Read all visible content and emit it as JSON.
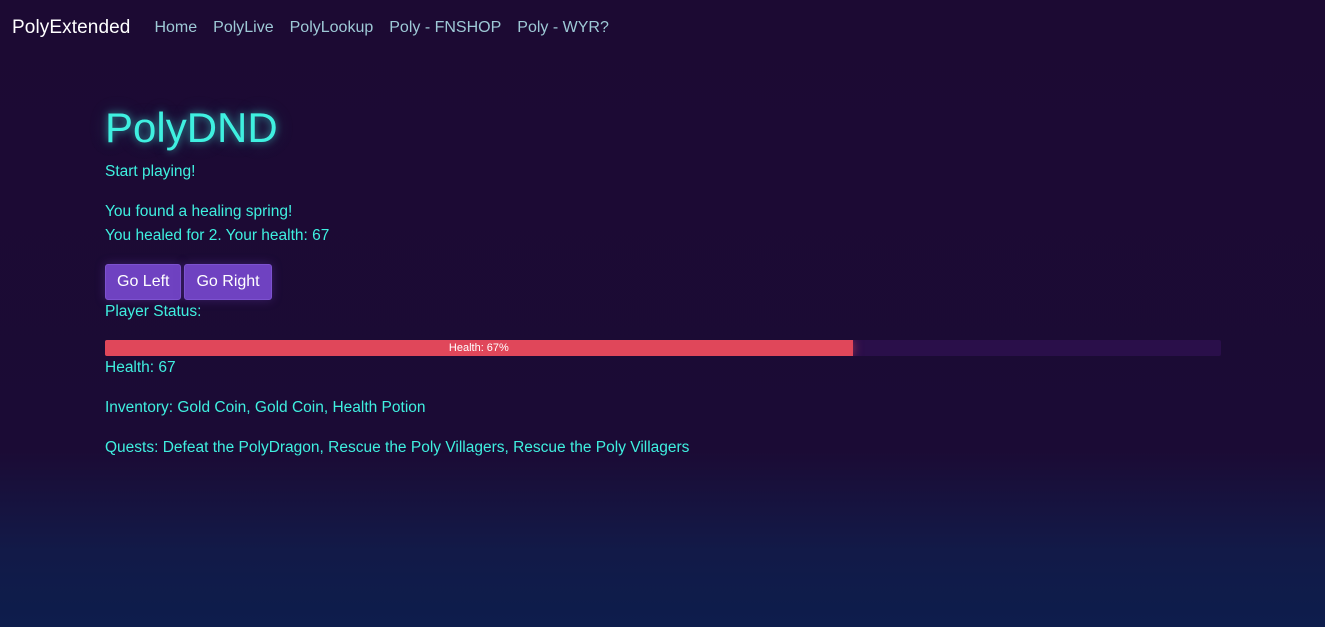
{
  "nav": {
    "brand": "PolyExtended",
    "links": [
      "Home",
      "PolyLive",
      "PolyLookup",
      "Poly - FNSHOP",
      "Poly - WYR?"
    ]
  },
  "game": {
    "title": "PolyDND",
    "start_text": "Start playing!",
    "event_line_1": "You found a healing spring!",
    "event_line_2": "You healed for 2. Your health: 67",
    "buttons": {
      "left": "Go Left",
      "right": "Go Right"
    },
    "status_label": "Player Status:",
    "health_bar": {
      "value": 67,
      "label": "Health: 67%"
    },
    "health_text": "Health: 67",
    "inventory_text": "Inventory: Gold Coin, Gold Coin, Health Potion",
    "quests_text": "Quests: Defeat the PolyDragon, Rescue the Poly Villagers, Rescue the Poly Villagers"
  },
  "colors": {
    "accent": "#3ff0e0",
    "button": "#6f42c1",
    "health_bar": "#e0475a",
    "background": "#1c0a33"
  }
}
